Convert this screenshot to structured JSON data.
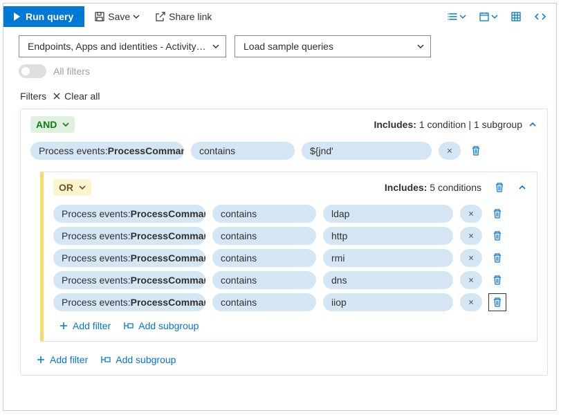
{
  "toolbar": {
    "run": "Run query",
    "save": "Save",
    "share": "Share link"
  },
  "selectors": {
    "scope": "Endpoints, Apps and identities - Activity…",
    "samples": "Load sample queries"
  },
  "all_filters_label": "All filters",
  "filters_label": "Filters",
  "clear_all": "Clear all",
  "logic": {
    "and": "AND",
    "or": "OR"
  },
  "includes_outer_prefix": "Includes:",
  "includes_outer_value": "1 condition | 1 subgroup",
  "includes_inner_prefix": "Includes:",
  "includes_inner_value": "5 conditions",
  "outer_row": {
    "field_prefix": "Process events: ",
    "field_bold": "ProcessComman…",
    "op": "contains",
    "val": "${jnd'"
  },
  "inner_rows": [
    {
      "field_prefix": "Process events: ",
      "field_bold": "ProcessComman…",
      "op": "contains",
      "val": "ldap"
    },
    {
      "field_prefix": "Process events: ",
      "field_bold": "ProcessComman…",
      "op": "contains",
      "val": "http"
    },
    {
      "field_prefix": "Process events: ",
      "field_bold": "ProcessComman…",
      "op": "contains",
      "val": "rmi"
    },
    {
      "field_prefix": "Process events: ",
      "field_bold": "ProcessComman…",
      "op": "contains",
      "val": "dns"
    },
    {
      "field_prefix": "Process events: ",
      "field_bold": "ProcessComman…",
      "op": "contains",
      "val": "iiop"
    }
  ],
  "add_filter": "Add filter",
  "add_subgroup": "Add subgroup"
}
